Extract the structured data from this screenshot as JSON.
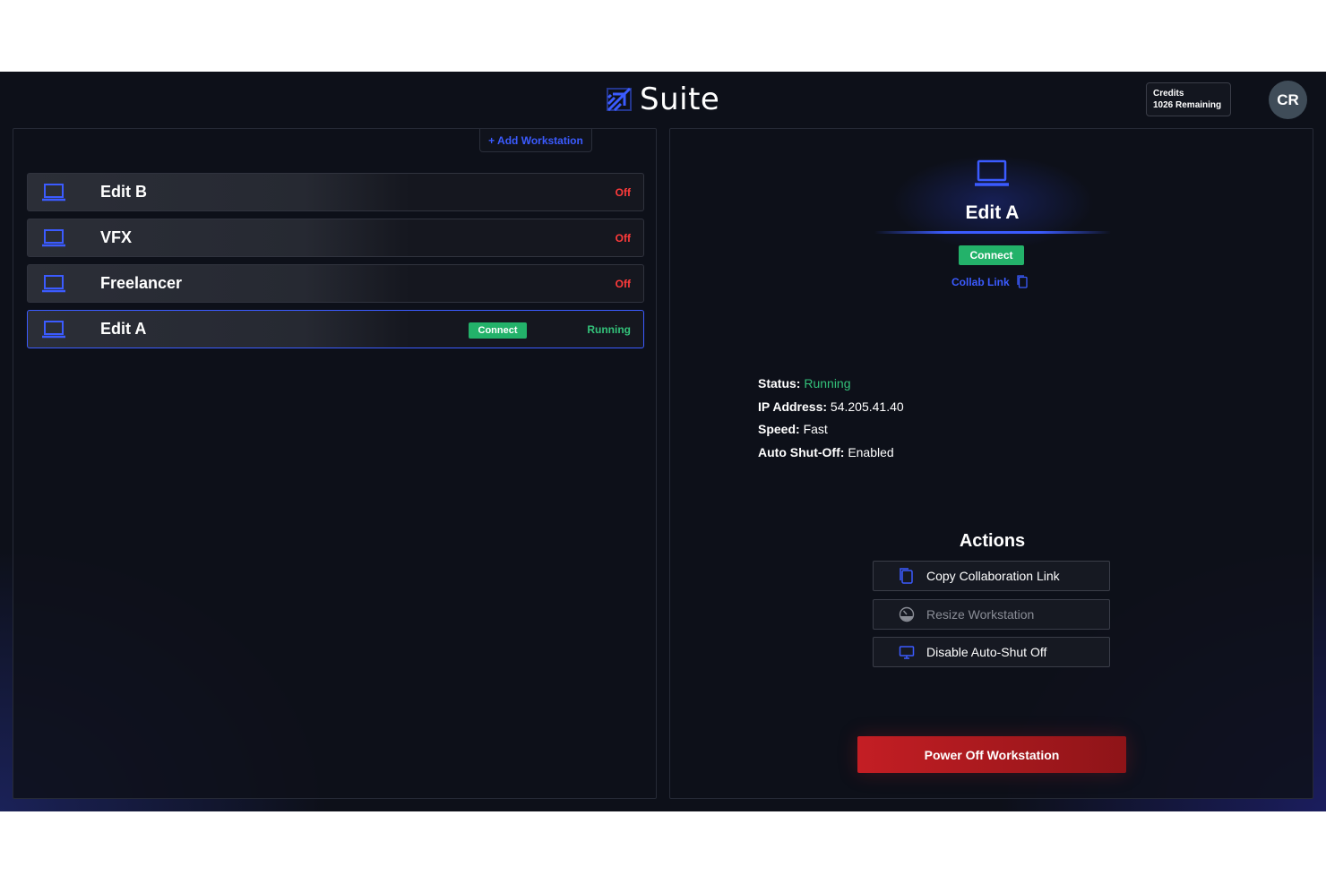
{
  "header": {
    "logo_text": "Suite",
    "credits": {
      "label": "Credits",
      "remaining": "1026 Remaining"
    },
    "avatar_initials": "CR"
  },
  "workstations": {
    "add_label": "+ Add Workstation",
    "items": [
      {
        "name": "Edit B",
        "status": "Off"
      },
      {
        "name": "VFX",
        "status": "Off"
      },
      {
        "name": "Freelancer",
        "status": "Off"
      },
      {
        "name": "Edit A",
        "status": "Running",
        "connect_label": "Connect",
        "selected": true
      }
    ]
  },
  "detail": {
    "title": "Edit A",
    "connect_label": "Connect",
    "collab_link_label": "Collab Link",
    "info": {
      "status_key": "Status:",
      "status_value": "Running",
      "ip_key": "IP Address:",
      "ip_value": "54.205.41.40",
      "speed_key": "Speed:",
      "speed_value": "Fast",
      "shutoff_key": "Auto Shut-Off:",
      "shutoff_value": "Enabled"
    },
    "actions_title": "Actions",
    "actions": [
      {
        "label": "Copy Collaboration Link",
        "icon": "copy-icon"
      },
      {
        "label": "Resize Workstation",
        "icon": "gauge-icon",
        "disabled": true
      },
      {
        "label": "Disable Auto-Shut Off",
        "icon": "monitor-icon"
      }
    ],
    "power_off_label": "Power Off Workstation"
  },
  "colors": {
    "accent": "#3b5bff",
    "running": "#33c27a",
    "off": "#ff3b3b",
    "connect": "#23b26a",
    "danger": "#c41e24"
  }
}
